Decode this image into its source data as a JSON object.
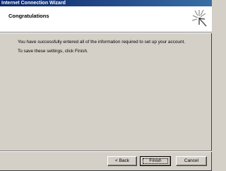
{
  "window": {
    "title": "Internet Connection Wizard"
  },
  "header": {
    "title": "Congratulations",
    "icon": "wizard-sparkle-icon"
  },
  "content": {
    "line1": "You have successfully entered all of the information required to set up your account.",
    "line2": "To save these settings, click Finish."
  },
  "buttons": {
    "back": "< Back",
    "finish": "Finish",
    "cancel": "Cancel"
  },
  "colors": {
    "titlebar_start": "#0a246a",
    "titlebar_end": "#3a6ea5",
    "dialog_bg": "#d4d0c8",
    "header_bg": "#ffffff"
  }
}
